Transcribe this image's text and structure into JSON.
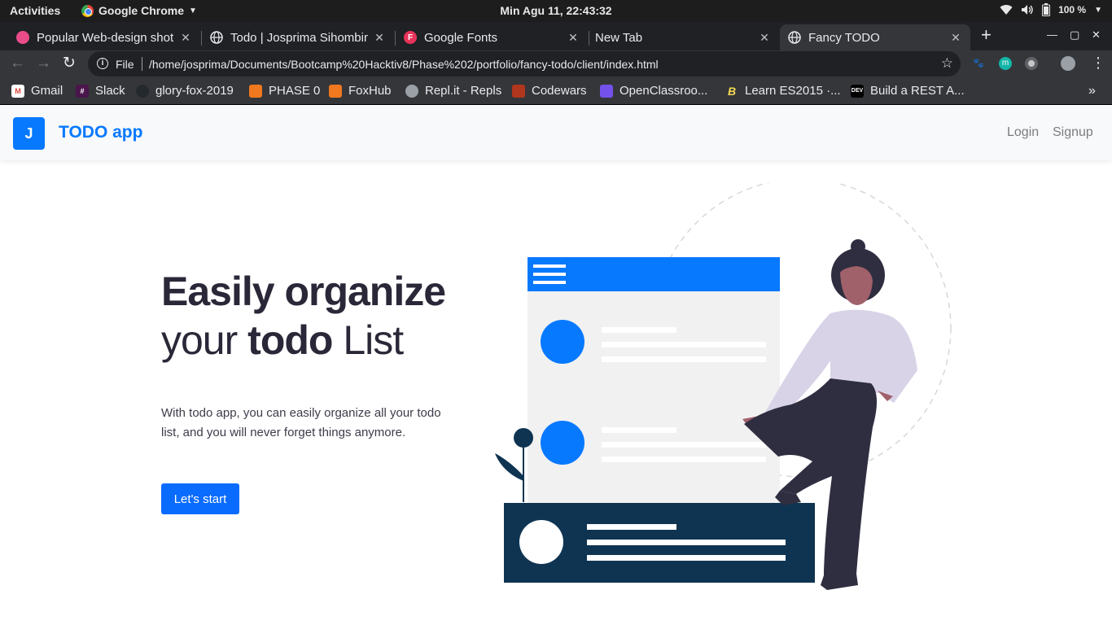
{
  "system": {
    "activities": "Activities",
    "app_name": "Google Chrome",
    "clock": "Min Agu 11, 22:43:32",
    "battery": "100 %"
  },
  "tabs": [
    {
      "title": "Popular Web-design shot",
      "fav_color": "#ea4c89"
    },
    {
      "title": "Todo | Josprima Sihombing",
      "fav_color": "#e8eaed"
    },
    {
      "title": "Google Fonts",
      "fav_color": "#e8335a",
      "fav_letter": "F"
    },
    {
      "title": "New Tab",
      "fav_color": ""
    },
    {
      "title": "Fancy TODO",
      "fav_color": "#e8eaed",
      "active": true
    }
  ],
  "omnibox": {
    "scheme": "File",
    "url": "/home/josprima/Documents/Bootcamp%20Hacktiv8/Phase%202/portfolio/fancy-todo/client/index.html"
  },
  "bookmarks": [
    {
      "label": "Gmail",
      "icon": "gmail-icon",
      "color": "#db4437"
    },
    {
      "label": "Slack",
      "icon": "slack-icon",
      "color": "#4a154b"
    },
    {
      "label": "glory-fox-2019",
      "icon": "github-icon",
      "color": "#333333"
    },
    {
      "label": "PHASE 0",
      "icon": "fox-icon",
      "color": "#f0781e"
    },
    {
      "label": "FoxHub",
      "icon": "fox-icon",
      "color": "#f0781e"
    },
    {
      "label": "Repl.it - Repls",
      "icon": "replit-icon",
      "color": "#9aa0a6"
    },
    {
      "label": "Codewars",
      "icon": "codewars-icon",
      "color": "#b1361e"
    },
    {
      "label": "OpenClassroo...",
      "icon": "openclassrooms-icon",
      "color": "#7451eb"
    },
    {
      "label": "Learn ES2015 ·...",
      "icon": "babel-icon",
      "color": "#f5da55"
    },
    {
      "label": "Build a REST A...",
      "icon": "dev-icon",
      "color": "#000000",
      "icon_text": "DEV"
    }
  ],
  "navbar": {
    "brand_letter": "J",
    "brand_name": "TODO app",
    "login": "Login",
    "signup": "Signup"
  },
  "hero": {
    "line1": "Easily organize",
    "line2_pre": "your ",
    "line2_bold": "todo",
    "line2_post": " List",
    "description": "With todo app, you can easily organize all your todo list, and you will never forget things anymore.",
    "cta": "Let's start"
  },
  "colors": {
    "brand": "#0779ff",
    "button": "#0a6cff",
    "heading": "#2a2838",
    "illustration_dark": "#0f3452"
  }
}
